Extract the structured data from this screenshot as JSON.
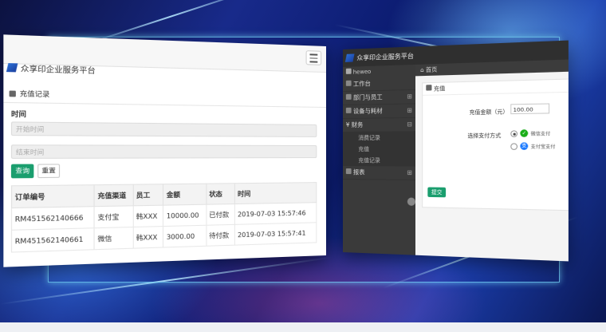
{
  "left_panel": {
    "brand": "众享印企业服务平台",
    "breadcrumb": "充值记录",
    "filter": {
      "label": "时间",
      "start_placeholder": "开始时间",
      "end_placeholder": "结束时间"
    },
    "buttons": {
      "query": "查询",
      "reset": "重置"
    },
    "table": {
      "headers": [
        "订单编号",
        "充值渠道",
        "员工",
        "金额",
        "状态",
        "时间"
      ],
      "rows": [
        [
          "RM451562140666",
          "支付宝",
          "韩XXX",
          "10000.00",
          "已付款",
          "2019-07-03 15:57:46"
        ],
        [
          "RM451562140661",
          "微信",
          "韩XXX",
          "3000.00",
          "待付款",
          "2019-07-03 15:57:41"
        ]
      ]
    }
  },
  "right_panel": {
    "brand": "众享印企业服务平台",
    "user": "heweo",
    "tab": "首页",
    "breadcrumb": "充值",
    "nav": [
      {
        "label": "工作台"
      },
      {
        "label": "部门与员工"
      },
      {
        "label": "设备与耗材"
      },
      {
        "label": "财务"
      }
    ],
    "sub_nav": [
      "消费记录",
      "充值",
      "充值记录"
    ],
    "nav_last": "报表",
    "form": {
      "amount_label": "充值金额（元）",
      "amount_value": "100.00",
      "pay_label": "选择支付方式",
      "pay_options": [
        "微信支付",
        "支付宝支付"
      ],
      "submit": "提交"
    },
    "colors": {
      "wechat": "#1aad19",
      "alipay": "#1677ff"
    }
  }
}
